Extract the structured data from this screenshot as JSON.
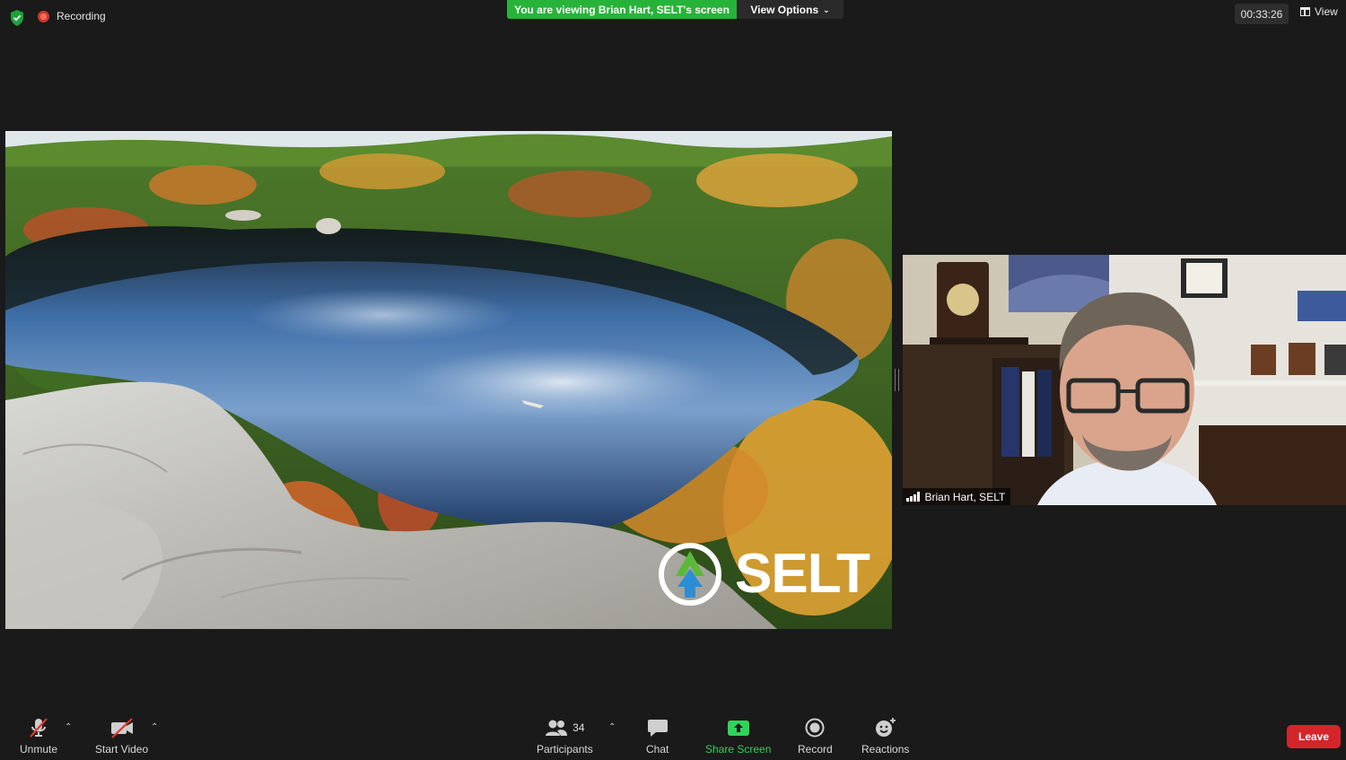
{
  "top_bar": {
    "recording_label": "Recording",
    "viewing_banner": "You are viewing Brian Hart, SELT's screen",
    "view_options_label": "View Options",
    "timer": "00:33:26",
    "view_label": "View"
  },
  "shared_screen": {
    "logo_text": "SELT"
  },
  "participant": {
    "name": "Brian Hart, SELT"
  },
  "toolbar": {
    "unmute_label": "Unmute",
    "start_video_label": "Start Video",
    "participants_label": "Participants",
    "participants_count": "34",
    "chat_label": "Chat",
    "share_screen_label": "Share Screen",
    "record_label": "Record",
    "reactions_label": "Reactions",
    "leave_label": "Leave"
  },
  "colors": {
    "banner_green": "#27b33a",
    "share_green": "#2fd45a",
    "leave_red": "#d3252a",
    "background": "#1a1a1a"
  }
}
